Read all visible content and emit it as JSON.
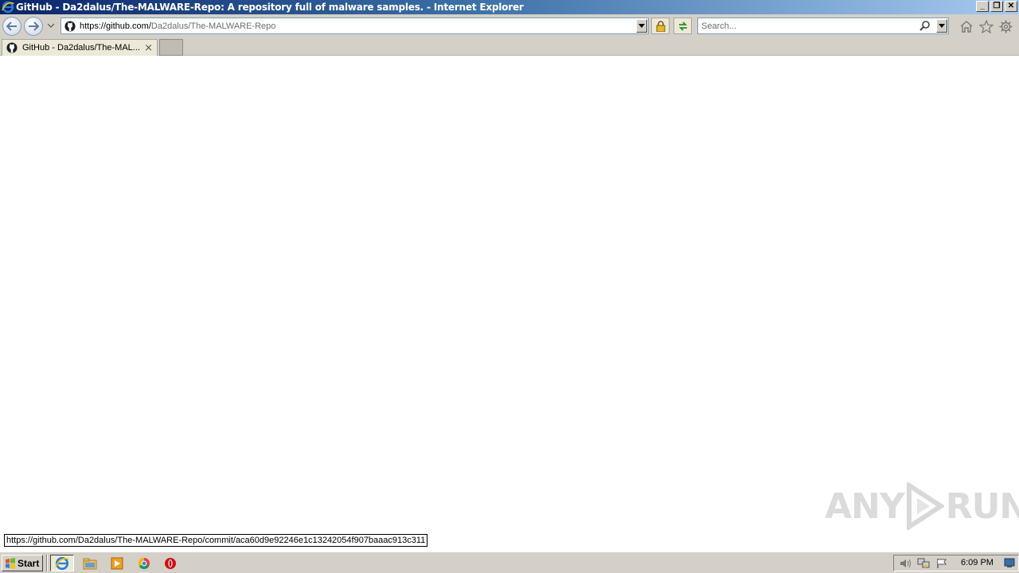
{
  "window": {
    "title": "GitHub - Da2dalus/The-MALWARE-Repo: A repository full of malware samples. - Internet Explorer",
    "minimize_label": "_",
    "restore_label": "❐",
    "close_label": "✕"
  },
  "navbar": {
    "address_host": "https://github.com/",
    "address_path": "Da2dalus/The-MALWARE-Repo",
    "search_placeholder": "Search...",
    "icons": [
      "back-arrow-icon",
      "forward-arrow-icon",
      "recent-pages-chevron-icon",
      "github-favicon-icon",
      "lock-icon",
      "compatibility-refresh-icon",
      "search-icon",
      "home-icon",
      "favorites-star-icon",
      "tools-gear-icon"
    ]
  },
  "tabs": [
    {
      "label": "GitHub - Da2dalus/The-MAL...",
      "close": "×"
    }
  ],
  "status": {
    "link": "https://github.com/Da2dalus/The-MALWARE-Repo/commit/aca60d9e92246e1c13242054f907baaac913c311"
  },
  "watermark": {
    "left": "ANY",
    "right": "RUN"
  },
  "taskbar": {
    "start_label": "Start",
    "items": [
      "internet-explorer-icon",
      "windows-explorer-icon",
      "media-player-icon",
      "chrome-icon",
      "opera-icon"
    ],
    "clock": "6:09 PM"
  },
  "colors": {
    "titlebar_start": "#0a246a",
    "titlebar_end": "#a6caf0",
    "chrome_gray": "#d4d0c8"
  }
}
